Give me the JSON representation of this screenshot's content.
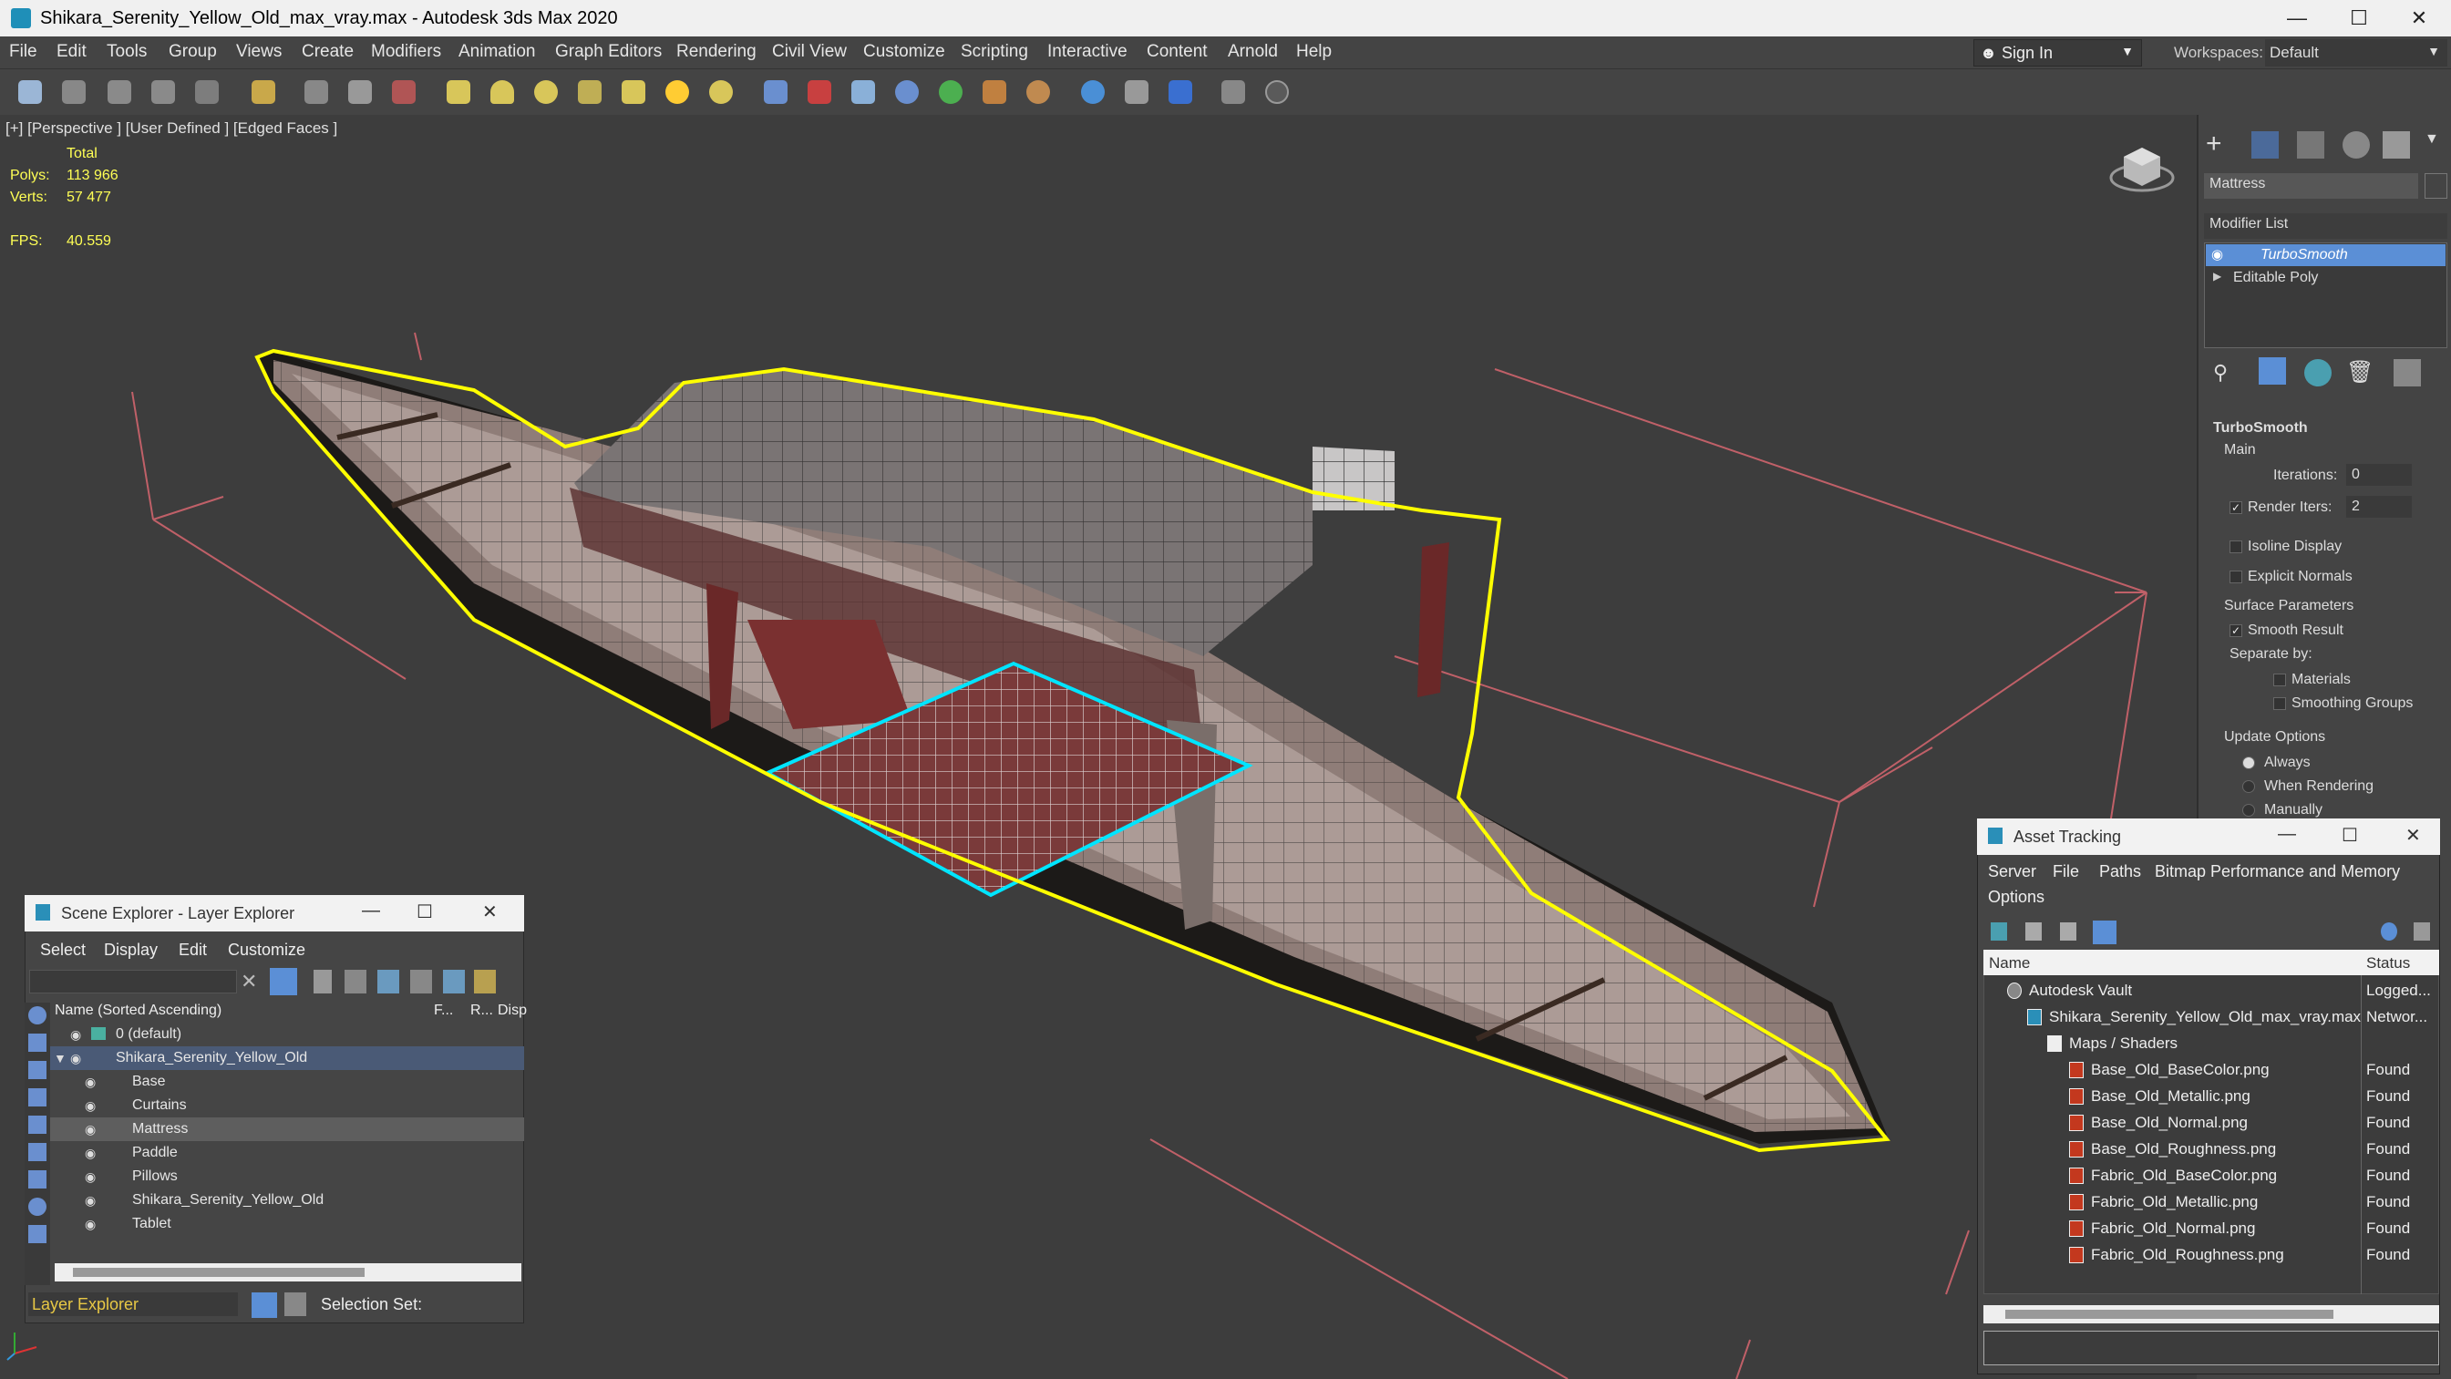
{
  "window": {
    "title": "Shikara_Serenity_Yellow_Old_max_vray.max - Autodesk 3ds Max 2020"
  },
  "menu": [
    "File",
    "Edit",
    "Tools",
    "Group",
    "Views",
    "Create",
    "Modifiers",
    "Animation",
    "Graph Editors",
    "Rendering",
    "Civil View",
    "Customize",
    "Scripting",
    "Interactive",
    "Content",
    "Arnold",
    "Help"
  ],
  "signin": {
    "label": "Sign In"
  },
  "workspaces": {
    "label": "Workspaces:",
    "value": "Default"
  },
  "viewport": {
    "label": "[+] [Perspective ] [User Defined ] [Edged Faces ]",
    "stats": {
      "total_label": "Total",
      "polys_label": "Polys:",
      "polys": "113 966",
      "verts_label": "Verts:",
      "verts": "57 477",
      "fps_label": "FPS:",
      "fps": "40.559"
    }
  },
  "command_panel": {
    "object_name": "Mattress",
    "modifier_list": "Modifier List",
    "stack": [
      "TurboSmooth",
      "Editable Poly"
    ],
    "rollout_title": "TurboSmooth",
    "main_label": "Main",
    "iterations_label": "Iterations:",
    "iterations": "0",
    "render_iters_label": "Render Iters:",
    "render_iters": "2",
    "isoline": "Isoline Display",
    "explicit_normals": "Explicit Normals",
    "surface_params": "Surface Parameters",
    "smooth_result": "Smooth Result",
    "separate_by": "Separate by:",
    "materials": "Materials",
    "smoothing_groups": "Smoothing Groups",
    "update_options": "Update Options",
    "always": "Always",
    "when_rendering": "When Rendering",
    "manually": "Manually"
  },
  "scene_explorer": {
    "title": "Scene Explorer - Layer Explorer",
    "menu": [
      "Select",
      "Display",
      "Edit",
      "Customize"
    ],
    "col_name": "Name (Sorted Ascending)",
    "col_f": "F...",
    "col_r": "R...",
    "col_d": "Disp",
    "rows": [
      "0 (default)",
      "Shikara_Serenity_Yellow_Old",
      "Base",
      "Curtains",
      "Mattress",
      "Paddle",
      "Pillows",
      "Shikara_Serenity_Yellow_Old",
      "Tablet"
    ],
    "footer_layer": "Layer Explorer",
    "footer_selection": "Selection Set:"
  },
  "asset_tracking": {
    "title": "Asset Tracking",
    "menu": [
      "Server",
      "File",
      "Paths",
      "Bitmap Performance and Memory",
      "Options"
    ],
    "col_name": "Name",
    "col_status": "Status",
    "rows": [
      {
        "name": "Autodesk Vault",
        "status": "Logged..."
      },
      {
        "name": "Shikara_Serenity_Yellow_Old_max_vray.max",
        "status": "Networ..."
      },
      {
        "name": "Maps / Shaders",
        "status": ""
      },
      {
        "name": "Base_Old_BaseColor.png",
        "status": "Found"
      },
      {
        "name": "Base_Old_Metallic.png",
        "status": "Found"
      },
      {
        "name": "Base_Old_Normal.png",
        "status": "Found"
      },
      {
        "name": "Base_Old_Roughness.png",
        "status": "Found"
      },
      {
        "name": "Fabric_Old_BaseColor.png",
        "status": "Found"
      },
      {
        "name": "Fabric_Old_Metallic.png",
        "status": "Found"
      },
      {
        "name": "Fabric_Old_Normal.png",
        "status": "Found"
      },
      {
        "name": "Fabric_Old_Roughness.png",
        "status": "Found"
      }
    ]
  },
  "colors": {
    "selection": "#ffff00",
    "highlight": "#00e5ff",
    "accent": "#5b8fd6"
  }
}
